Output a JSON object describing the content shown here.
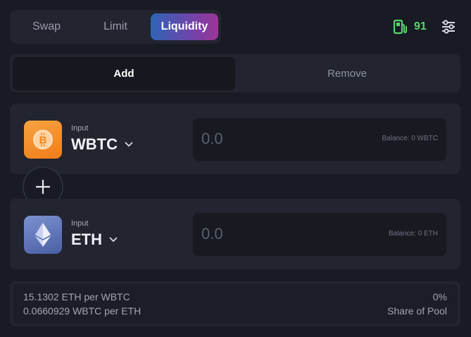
{
  "tabs": {
    "swap": "Swap",
    "limit": "Limit",
    "liquidity": "Liquidity",
    "active": "Liquidity"
  },
  "gas": {
    "value": "91",
    "icon": "gas-pump-icon",
    "color": "#58d66a"
  },
  "settings": {
    "icon": "sliders-icon"
  },
  "mode": {
    "add": "Add",
    "remove": "Remove",
    "active": "Add"
  },
  "inputs": [
    {
      "label": "Input",
      "token": "WBTC",
      "icon": "bitcoin-icon",
      "amount_placeholder": "0.0",
      "balance": "Balance: 0 WBTC",
      "icon_color": "#f7931a"
    },
    {
      "label": "Input",
      "token": "ETH",
      "icon": "ethereum-icon",
      "amount_placeholder": "0.0",
      "balance": "Balance: 0 ETH",
      "icon_color": "#627eea"
    }
  ],
  "pool_info": {
    "rate_1": "15.1302 ETH per WBTC",
    "rate_2": "0.0660929 WBTC per ETH",
    "share_value": "0%",
    "share_label": "Share of Pool"
  },
  "colors": {
    "background": "#181a24",
    "card": "#22242f",
    "accent_gradient_start": "#2f64b8",
    "accent_gradient_end": "#9c3696"
  }
}
